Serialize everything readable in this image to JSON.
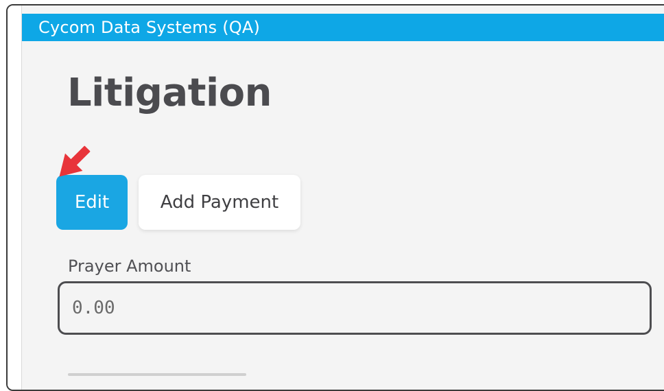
{
  "header": {
    "title": "Cycom Data Systems (QA)"
  },
  "page": {
    "title": "Litigation"
  },
  "actions": {
    "edit_label": "Edit",
    "add_payment_label": "Add Payment"
  },
  "fields": {
    "prayer_amount": {
      "label": "Prayer Amount",
      "placeholder": "0.00",
      "value": ""
    }
  },
  "annotations": {
    "arrow_icon": "red-arrow-pointer"
  },
  "colors": {
    "header_bg": "#0ea7e6",
    "primary_button": "#1aa6e3",
    "arrow": "#e8343a",
    "page_bg": "#f4f4f4",
    "title_text": "#4b4b4f"
  }
}
